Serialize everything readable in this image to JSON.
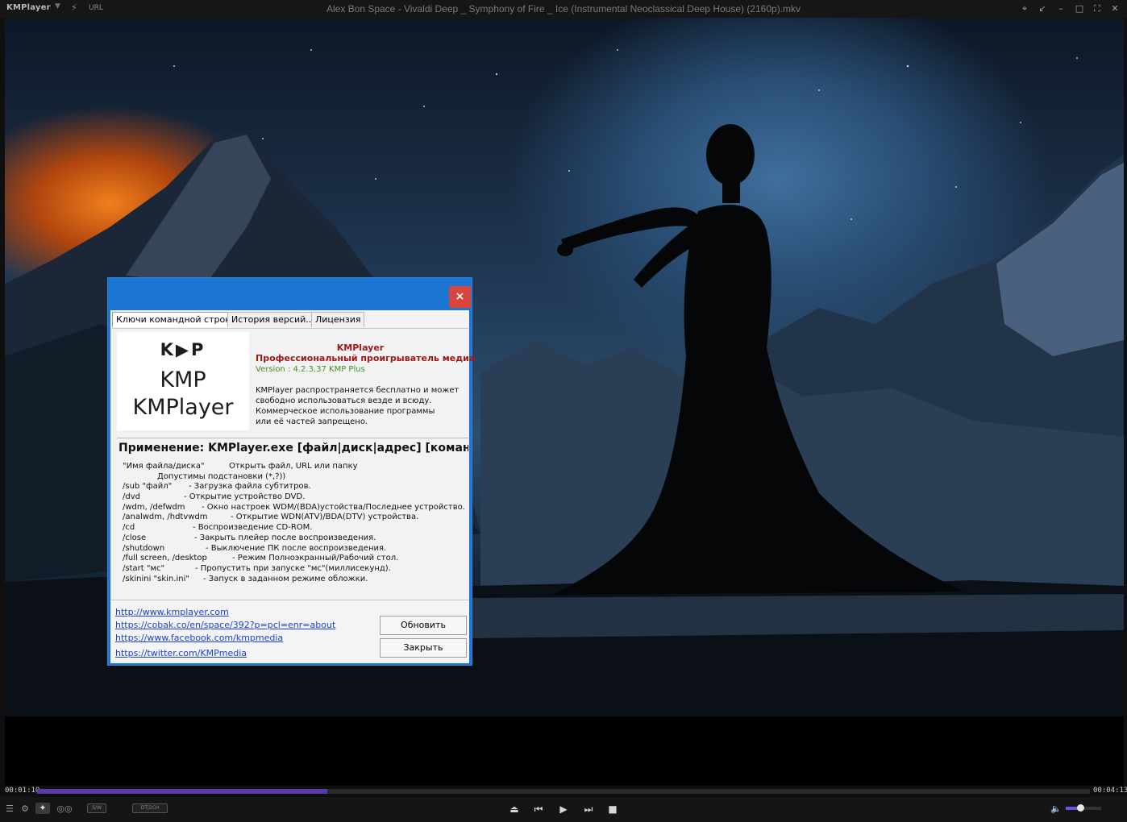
{
  "window": {
    "app_logo": "KMPlayer",
    "logo_arrow": "▼",
    "url_label": "URL",
    "title": "Alex Bon Space - Vivaldi Deep _ Symphony of Fire _ Ice (Instrumental Neoclassical Deep House) (2160p).mkv",
    "controls": [
      "pin-icon",
      "minimize-to-tray-icon",
      "minimize-icon",
      "maximize-icon",
      "fullscreen-icon",
      "close-icon"
    ]
  },
  "player": {
    "current_time": "00:01:10",
    "total_time": "00:04:13",
    "progress": 0.276,
    "volume": 0.4,
    "tag_sw": "S/W",
    "tag_dt": "DT|2CH"
  },
  "dialog": {
    "close_glyph": "×",
    "tabs": [
      "Ключи командной строки",
      "История версий...",
      "Лицензия"
    ],
    "logo_mark": "K▶P",
    "logo_big": "KMP",
    "logo_name": "KMPlayer",
    "app_name": "KMPlayer",
    "app_subtitle": "Профессиональный проигрыватель медиа",
    "version": "Version : 4.2.3.37 KMP Plus",
    "description": [
      "KMPlayer распространяется бесплатно и может",
      "свободно использоваться везде и всюду.",
      "Коммерческое использование программы",
      "или её частей запрещено."
    ],
    "usage": "Применение: KMPlayer.exe  [файл|диск|адрес] [команд",
    "commands": [
      {
        "key": "\"Имя файла/диска\"",
        "desc": "Открыть файл, URL или папку"
      },
      {
        "key": "",
        "desc": "Допустимы подстановки (*,?))"
      },
      {
        "key": "/sub \"файл\"",
        "desc": "- Загрузка файла субтитров."
      },
      {
        "key": "/dvd",
        "desc": "- Открытие устройство DVD."
      },
      {
        "key": "/wdm, /defwdm",
        "desc": "- Окно настроек WDM/(BDA)устойства/Последнее устройство."
      },
      {
        "key": "/analwdm, /hdtvwdm",
        "desc": "- Открытие WDN(ATV)/BDA(DTV) устройства."
      },
      {
        "key": "/cd",
        "desc": "- Воспроизведение CD-ROM."
      },
      {
        "key": "/close",
        "desc": "- Закрыть плейер после воспроизведения."
      },
      {
        "key": "/shutdown",
        "desc": "- Выключение ПК после воспроизведения."
      },
      {
        "key": "/full screen, /desktop",
        "desc": "- Режим Полноэкранный/Рабочий стол."
      },
      {
        "key": "/start \"мс\"",
        "desc": "- Пропустить при запуске \"мс\"(миллисекунд)."
      },
      {
        "key": "/skinini \"skin.ini\"",
        "desc": "- Запуск в заданном режиме обложки."
      }
    ],
    "links": [
      "http://www.kmplayer.com",
      "https://cobak.co/en/space/392?p=pcl=enr=about",
      "https://www.facebook.com/kmpmedia",
      "https://twitter.com/KMPmedia"
    ],
    "update_button": "Обновить",
    "close_button": "Закрыть"
  },
  "colors": {
    "dialog_accent": "#1a76d2",
    "close_red": "#d9453c",
    "seek_fill": "#5a3aa6",
    "app_name_red": "#9d1818",
    "version_green": "#3f8f24",
    "link_blue": "#1c3fd6"
  }
}
